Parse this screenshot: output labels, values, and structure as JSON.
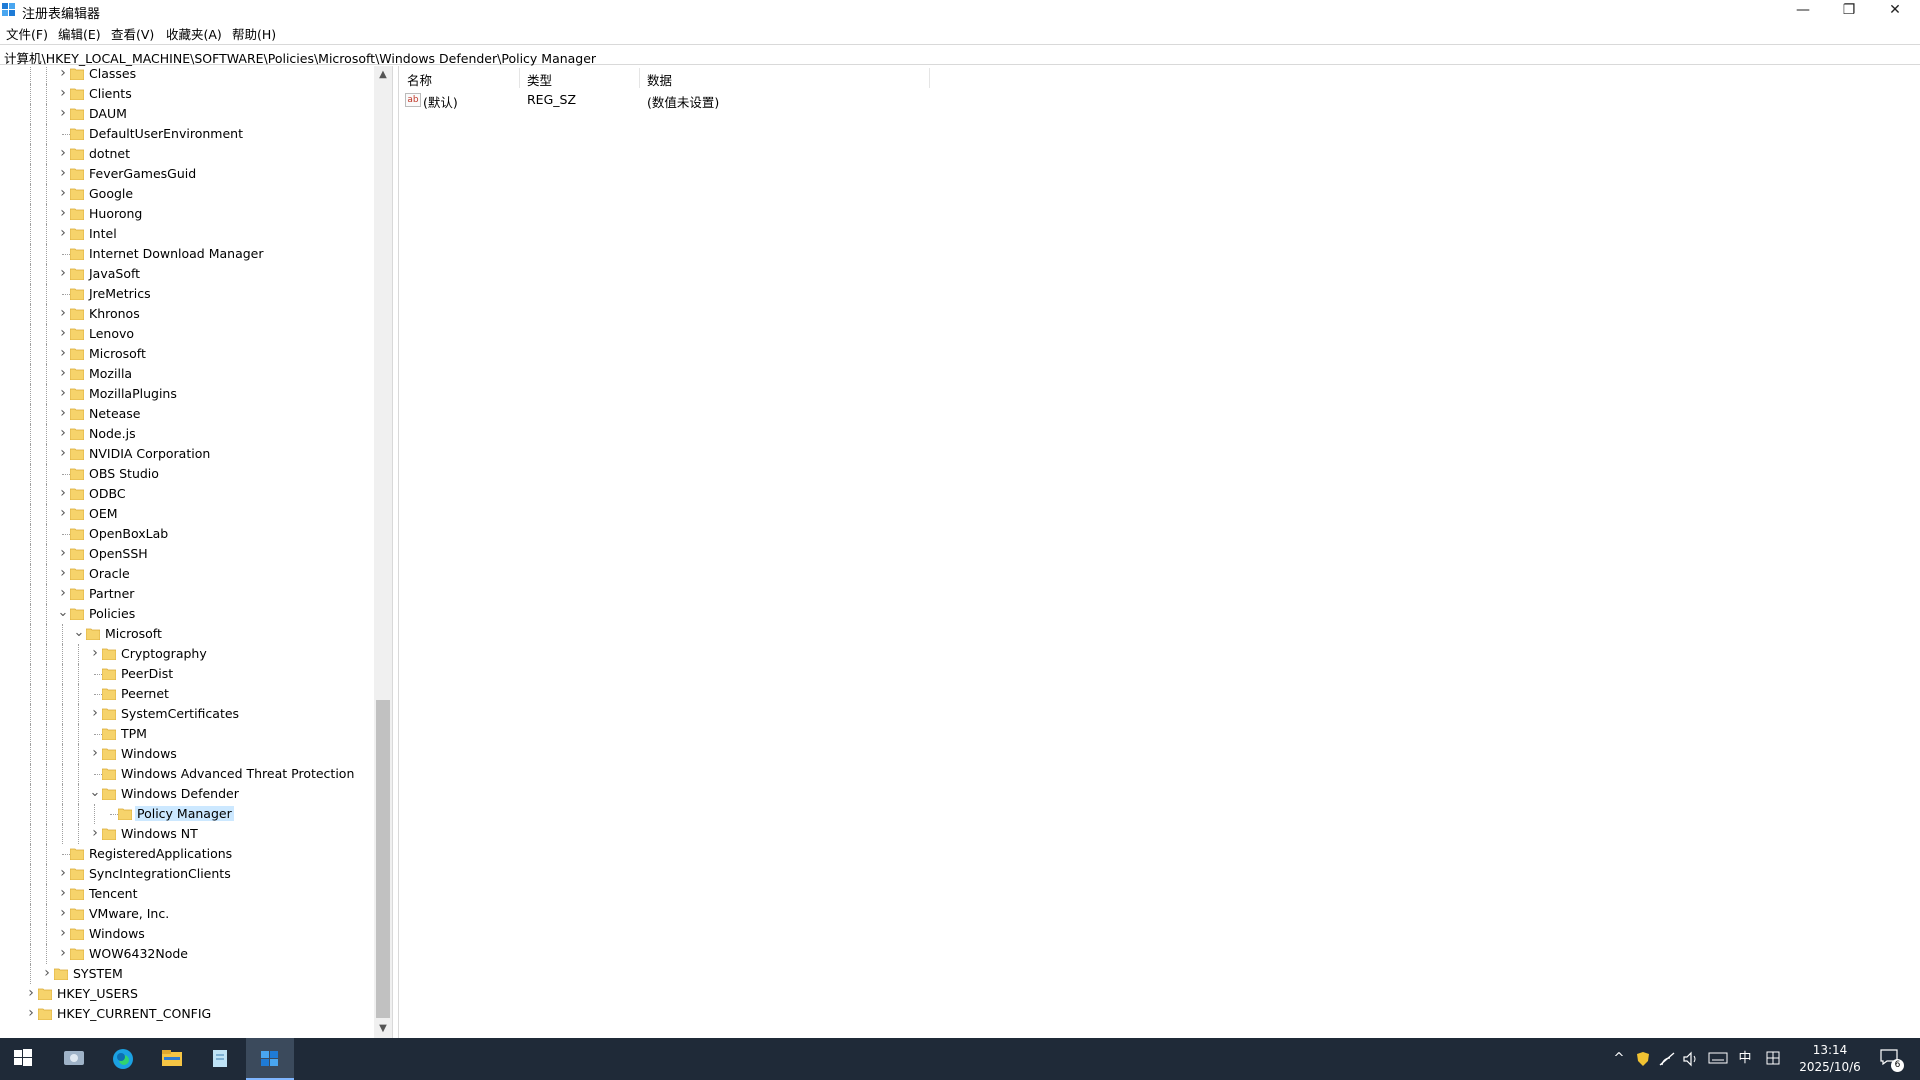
{
  "window": {
    "title": "注册表编辑器",
    "minimize_icon": "minimize-icon",
    "maximize_icon": "restore-icon",
    "close_icon": "close-icon"
  },
  "menu": [
    "文件(F)",
    "编辑(E)",
    "查看(V)",
    "收藏夹(A)",
    "帮助(H)"
  ],
  "address": "计算机\\HKEY_LOCAL_MACHINE\\SOFTWARE\\Policies\\Microsoft\\Windows Defender\\Policy Manager",
  "tree": {
    "items": [
      {
        "label": "Classes",
        "level": 3,
        "expander": "collapsed"
      },
      {
        "label": "Clients",
        "level": 3,
        "expander": "collapsed"
      },
      {
        "label": "DAUM",
        "level": 3,
        "expander": "collapsed"
      },
      {
        "label": "DefaultUserEnvironment",
        "level": 3,
        "expander": "none"
      },
      {
        "label": "dotnet",
        "level": 3,
        "expander": "collapsed"
      },
      {
        "label": "FeverGamesGuid",
        "level": 3,
        "expander": "collapsed"
      },
      {
        "label": "Google",
        "level": 3,
        "expander": "collapsed"
      },
      {
        "label": "Huorong",
        "level": 3,
        "expander": "collapsed"
      },
      {
        "label": "Intel",
        "level": 3,
        "expander": "collapsed"
      },
      {
        "label": "Internet Download Manager",
        "level": 3,
        "expander": "none"
      },
      {
        "label": "JavaSoft",
        "level": 3,
        "expander": "collapsed"
      },
      {
        "label": "JreMetrics",
        "level": 3,
        "expander": "none"
      },
      {
        "label": "Khronos",
        "level": 3,
        "expander": "collapsed"
      },
      {
        "label": "Lenovo",
        "level": 3,
        "expander": "collapsed"
      },
      {
        "label": "Microsoft",
        "level": 3,
        "expander": "collapsed"
      },
      {
        "label": "Mozilla",
        "level": 3,
        "expander": "collapsed"
      },
      {
        "label": "MozillaPlugins",
        "level": 3,
        "expander": "collapsed"
      },
      {
        "label": "Netease",
        "level": 3,
        "expander": "collapsed"
      },
      {
        "label": "Node.js",
        "level": 3,
        "expander": "collapsed"
      },
      {
        "label": "NVIDIA Corporation",
        "level": 3,
        "expander": "collapsed"
      },
      {
        "label": "OBS Studio",
        "level": 3,
        "expander": "none"
      },
      {
        "label": "ODBC",
        "level": 3,
        "expander": "collapsed"
      },
      {
        "label": "OEM",
        "level": 3,
        "expander": "collapsed"
      },
      {
        "label": "OpenBoxLab",
        "level": 3,
        "expander": "none"
      },
      {
        "label": "OpenSSH",
        "level": 3,
        "expander": "collapsed"
      },
      {
        "label": "Oracle",
        "level": 3,
        "expander": "collapsed"
      },
      {
        "label": "Partner",
        "level": 3,
        "expander": "collapsed"
      },
      {
        "label": "Policies",
        "level": 3,
        "expander": "expanded"
      },
      {
        "label": "Microsoft",
        "level": 4,
        "expander": "expanded"
      },
      {
        "label": "Cryptography",
        "level": 5,
        "expander": "collapsed"
      },
      {
        "label": "PeerDist",
        "level": 5,
        "expander": "none"
      },
      {
        "label": "Peernet",
        "level": 5,
        "expander": "none"
      },
      {
        "label": "SystemCertificates",
        "level": 5,
        "expander": "collapsed"
      },
      {
        "label": "TPM",
        "level": 5,
        "expander": "none"
      },
      {
        "label": "Windows",
        "level": 5,
        "expander": "collapsed"
      },
      {
        "label": "Windows Advanced Threat Protection",
        "level": 5,
        "expander": "none"
      },
      {
        "label": "Windows Defender",
        "level": 5,
        "expander": "expanded"
      },
      {
        "label": "Policy Manager",
        "level": 6,
        "expander": "none",
        "selected": true
      },
      {
        "label": "Windows NT",
        "level": 5,
        "expander": "collapsed"
      },
      {
        "label": "RegisteredApplications",
        "level": 3,
        "expander": "none"
      },
      {
        "label": "SyncIntegrationClients",
        "level": 3,
        "expander": "collapsed"
      },
      {
        "label": "Tencent",
        "level": 3,
        "expander": "collapsed"
      },
      {
        "label": "VMware, Inc.",
        "level": 3,
        "expander": "collapsed"
      },
      {
        "label": "Windows",
        "level": 3,
        "expander": "collapsed"
      },
      {
        "label": "WOW6432Node",
        "level": 3,
        "expander": "collapsed"
      },
      {
        "label": "SYSTEM",
        "level": 2,
        "expander": "collapsed"
      },
      {
        "label": "HKEY_USERS",
        "level": 1,
        "expander": "collapsed"
      },
      {
        "label": "HKEY_CURRENT_CONFIG",
        "level": 1,
        "expander": "collapsed"
      }
    ]
  },
  "list": {
    "columns": [
      "名称",
      "类型",
      "数据"
    ],
    "rows": [
      {
        "name": "(默认)",
        "type": "REG_SZ",
        "data": "(数值未设置)",
        "icon": "ab-string-icon",
        "icon_text": "ab"
      }
    ]
  },
  "taskbar": {
    "apps": [
      "start-icon",
      "photos-icon",
      "edge-icon",
      "file-explorer-icon",
      "notepad-icon",
      "regedit-icon"
    ],
    "tray": {
      "chevron": "^",
      "ime": "中"
    },
    "time": "13:14",
    "date": "2025/10/6",
    "notification_count": "6"
  },
  "colors": {
    "selection": "#cce8ff",
    "taskbar": "#1f2a38",
    "folder": "#f6d36b"
  }
}
